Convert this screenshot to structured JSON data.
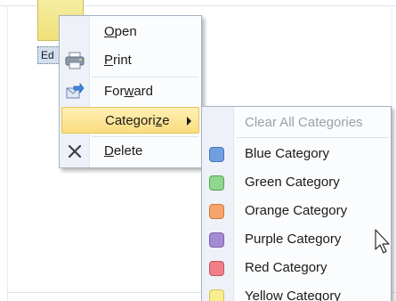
{
  "note": {
    "label": "Ed"
  },
  "context_menu": {
    "items": [
      {
        "label_prefix": "",
        "label_underline": "O",
        "label_rest": "pen",
        "icon": "none"
      },
      {
        "label_prefix": "",
        "label_underline": "P",
        "label_rest": "rint",
        "icon": "printer-icon"
      },
      {
        "label_prefix": "For",
        "label_underline": "w",
        "label_rest": "ard",
        "icon": "forward-icon"
      },
      {
        "label_prefix": "Categori",
        "label_underline": "z",
        "label_rest": "e",
        "icon": "none",
        "highlighted": true
      },
      {
        "label_prefix": "",
        "label_underline": "D",
        "label_rest": "elete",
        "icon": "delete-x-icon"
      }
    ]
  },
  "category_submenu": {
    "clear_label": "Clear All Categories",
    "items": [
      {
        "label": "Blue Category",
        "color": "#6f9fe0",
        "border": "#4a74b5"
      },
      {
        "label": "Green Category",
        "color": "#8fd68f",
        "border": "#57a457"
      },
      {
        "label": "Orange Category",
        "color": "#f6a46a",
        "border": "#d5773a"
      },
      {
        "label": "Purple Category",
        "color": "#a58bd2",
        "border": "#7a5ea9"
      },
      {
        "label": "Red Category",
        "color": "#ef7e86",
        "border": "#c8515b"
      },
      {
        "label": "Yellow Category",
        "color": "#f7ef8e",
        "border": "#cfc35a"
      }
    ]
  }
}
